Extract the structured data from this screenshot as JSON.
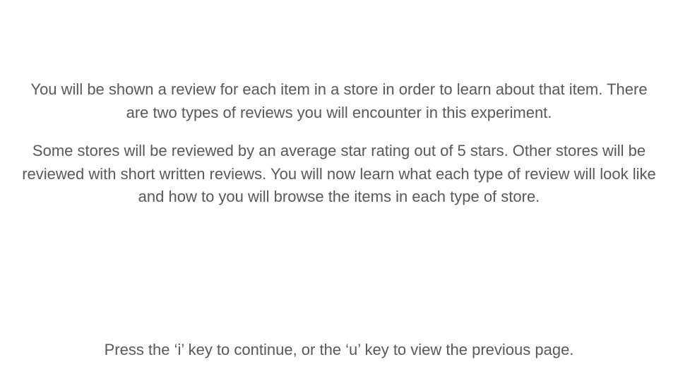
{
  "instructions": {
    "paragraph_1": "You will be shown a review for each item in a store in order to learn about that item. There are two types of reviews you will encounter in this experiment.",
    "paragraph_2": "Some stores will be reviewed by an average star rating out of 5 stars. Other stores will be reviewed with short written reviews. You will now learn what each type of review will look like and how to you will browse the items in each type of store."
  },
  "footer": {
    "prompt": "Press the ‘i’ key to continue, or the ‘u’ key to view the previous page."
  },
  "colors": {
    "background": "#ffffff",
    "text": "#595959"
  }
}
